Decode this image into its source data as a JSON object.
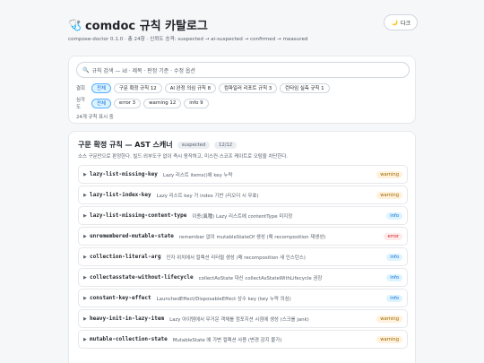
{
  "header": {
    "icon": "stethoscope-icon",
    "title": "comdoc 규칙 카탈로그",
    "subtitle": "compose-doctor 0.1.0 · 총 24항 · 신뢰도 승격: suspected → ai-suspected → confirmed → measured",
    "theme_icon": "🌙",
    "theme_label": "다크"
  },
  "search": {
    "icon": "🔍",
    "placeholder": "규칙 검색 — id · 제목 · 판정 기준 · 수정 옵션"
  },
  "filters": {
    "tier_label": "결회",
    "tiers": [
      {
        "label": "전체",
        "active": true
      },
      {
        "label": "구문 확정 규칙 12",
        "active": false
      },
      {
        "label": "AI 완정 의심 규칙 8",
        "active": false
      },
      {
        "label": "컴파일러 리포트 규칙 3",
        "active": false
      },
      {
        "label": "런타임 실측 규칙 1",
        "active": false
      }
    ],
    "severity_label": "심각도",
    "severities": [
      {
        "label": "전체",
        "active": true
      },
      {
        "label": "error 3",
        "active": false
      },
      {
        "label": "warning 12",
        "active": false
      },
      {
        "label": "info 9",
        "active": false
      }
    ],
    "count_text": "24개 규칙 표시 중"
  },
  "section": {
    "title": "구문 확정 규칙 — AST 스캐너",
    "tier_badge": "suspected",
    "count_badge": "12/12",
    "description": "소스 구문만으로 판정한다. 빌드·외부도구 없이 즉시 동작하고, 미스컨·스코프 케이트로 오탐을 차단한다.",
    "rules": [
      {
        "id": "lazy-list-missing-key",
        "desc": "Lazy 리스트 items()에 key 누락",
        "severity": "warning"
      },
      {
        "id": "lazy-list-index-key",
        "desc": "Lazy 리스트 key 가 index 기반 (리오더 시 무효)",
        "severity": "warning"
      },
      {
        "id": "lazy-list-missing-content-type",
        "desc": "이종(異種) Lazy 리스트에 contentType 미지정",
        "severity": "info"
      },
      {
        "id": "unremembered-mutable-state",
        "desc": "remember 없이 mutableStateOf 생성 (매 recomposition 재생성)",
        "severity": "error"
      },
      {
        "id": "collection-literal-arg",
        "desc": "인자 위치에서 컬렉션 리터럴 생성 (매 recomposition 새 인스턴스)",
        "severity": "info"
      },
      {
        "id": "collectasstate-without-lifecycle",
        "desc": "collectAsState 대신 collectAsStateWithLifecycle 권장",
        "severity": "info"
      },
      {
        "id": "constant-key-effect",
        "desc": "LaunchedEffect/DisposableEffect 상수 key (key 누락 의심)",
        "severity": "info"
      },
      {
        "id": "heavy-init-in-lazy-item",
        "desc": "Lazy 아이템에서 무거운 객체를 컴포지션 시점에 생성 (스크롤 jank)",
        "severity": "warning"
      },
      {
        "id": "mutable-collection-state",
        "desc": "MutableState 에 가변 컬렉션 사용 (변경 감지 불가)",
        "severity": "warning"
      }
    ]
  }
}
